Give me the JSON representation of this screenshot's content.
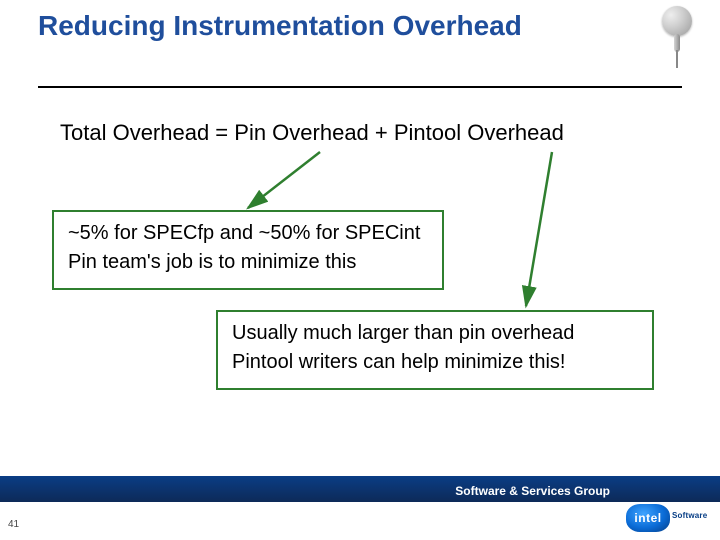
{
  "title": "Reducing Instrumentation Overhead",
  "equation": "Total Overhead = Pin Overhead + Pintool Overhead",
  "box_left": {
    "line1": "~5% for SPECfp and ~50% for SPECint",
    "line2": "Pin team's job is to minimize this"
  },
  "box_right": {
    "line1": "Usually much larger than pin overhead",
    "line2": "Pintool writers can help minimize this!"
  },
  "footer": "Software & Services Group",
  "logo": {
    "badge": "intel",
    "sub": "Software"
  },
  "page_number": "41"
}
